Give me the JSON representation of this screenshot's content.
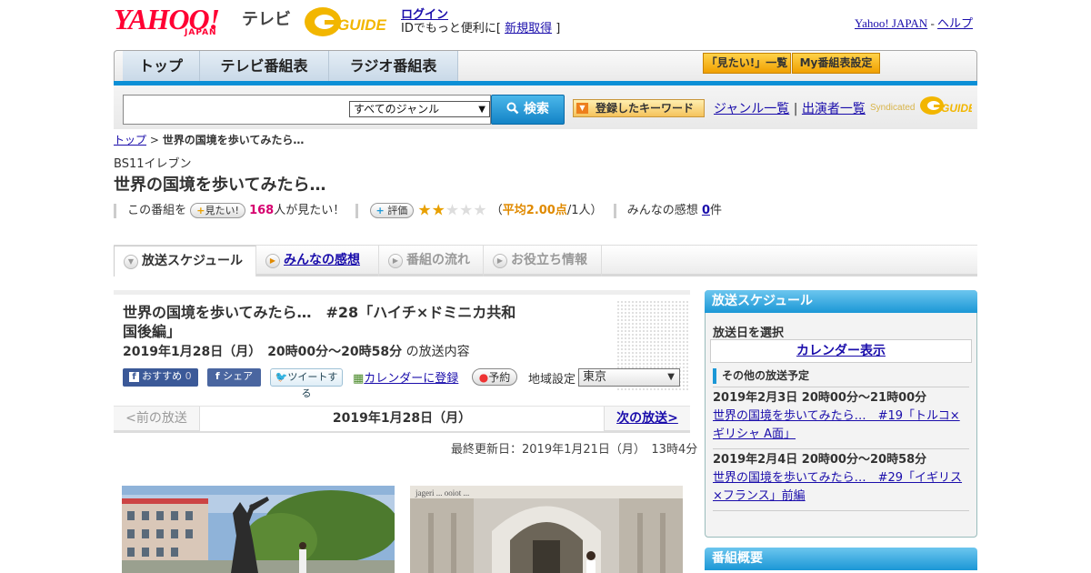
{
  "header": {
    "yahoo_logo": "YAHOO!",
    "yahoo_japan": "JAPAN",
    "tv_label": "テレビ",
    "gguide_logo": "GUIDE",
    "login": "ログイン",
    "signup_prefix": "IDでもっと便利に[",
    "signup": "新規取得",
    "signup_suffix": "]",
    "yahoo_japan_link": "Yahoo! JAPAN",
    "dash": "-",
    "help": "ヘルプ"
  },
  "nav": {
    "tabs": [
      "トップ",
      "テレビ番組表",
      "ラジオ番組表"
    ],
    "want_list": "「見たい!」一覧",
    "my_schedule": "My番組表設定"
  },
  "search": {
    "genre_selected": "すべてのジャンル",
    "button": "検索",
    "keyword_button": "登録したキーワード",
    "genre_list": "ジャンル一覧",
    "separator": "|",
    "performer_list": "出演者一覧",
    "syndicated": "Syndicated"
  },
  "breadcrumb": {
    "top": "トップ",
    "sep": ">",
    "current": "世界の国境を歩いてみたら…"
  },
  "program": {
    "channel": "BS11イレブン",
    "title": "世界の国境を歩いてみたら…",
    "want_prefix": "この番組を",
    "want_button": "見たい!",
    "want_count": "168",
    "want_suffix": "人が見たい！",
    "rating_button": "評価",
    "rating_value": 2,
    "rating_open": "（",
    "rating_avg": "平均2.00点",
    "rating_people": "/1人）",
    "impressions_label": "みんなの感想",
    "impressions_count": "0",
    "impressions_unit": "件"
  },
  "tabs": [
    "放送スケジュール",
    "みんなの感想",
    "番組の流れ",
    "お役立ち情報"
  ],
  "episode": {
    "title": "世界の国境を歩いてみたら…　#28「ハイチ×ドミニカ共和国後編」",
    "datetime": "2019年1月28日（月）　20時00分～20時58分",
    "datetime_suffix": "の放送内容",
    "recommend": "おすすめ",
    "recommend_count": "0",
    "share": "シェア",
    "tweet": "ツイートする",
    "calendar": "カレンダーに登録",
    "reserve": "予約",
    "region_label": "地域設定",
    "region_value": "東京"
  },
  "prevnext": {
    "prev": "<前の放送",
    "date": "2019年1月28日（月）",
    "next": "次の放送>"
  },
  "updated": "最終更新日：2019年1月21日（月）　13時4分",
  "sidebar": {
    "schedule_header": "放送スケジュール",
    "select_date": "放送日を選択",
    "calendar_button": "カレンダー表示",
    "other_schedule": "その他の放送予定",
    "items": [
      {
        "time": "2019年2月3日  20時00分～21時00分",
        "title": "世界の国境を歩いてみたら…　#19「トルコ×ギリシャ A面」"
      },
      {
        "time": "2019年2月4日  20時00分～20時58分",
        "title": "世界の国境を歩いてみたら…　#29「イギリス×フランス」前編"
      }
    ],
    "overview_header": "番組概要"
  },
  "photo_caption": "jageri ... ooiot ..."
}
